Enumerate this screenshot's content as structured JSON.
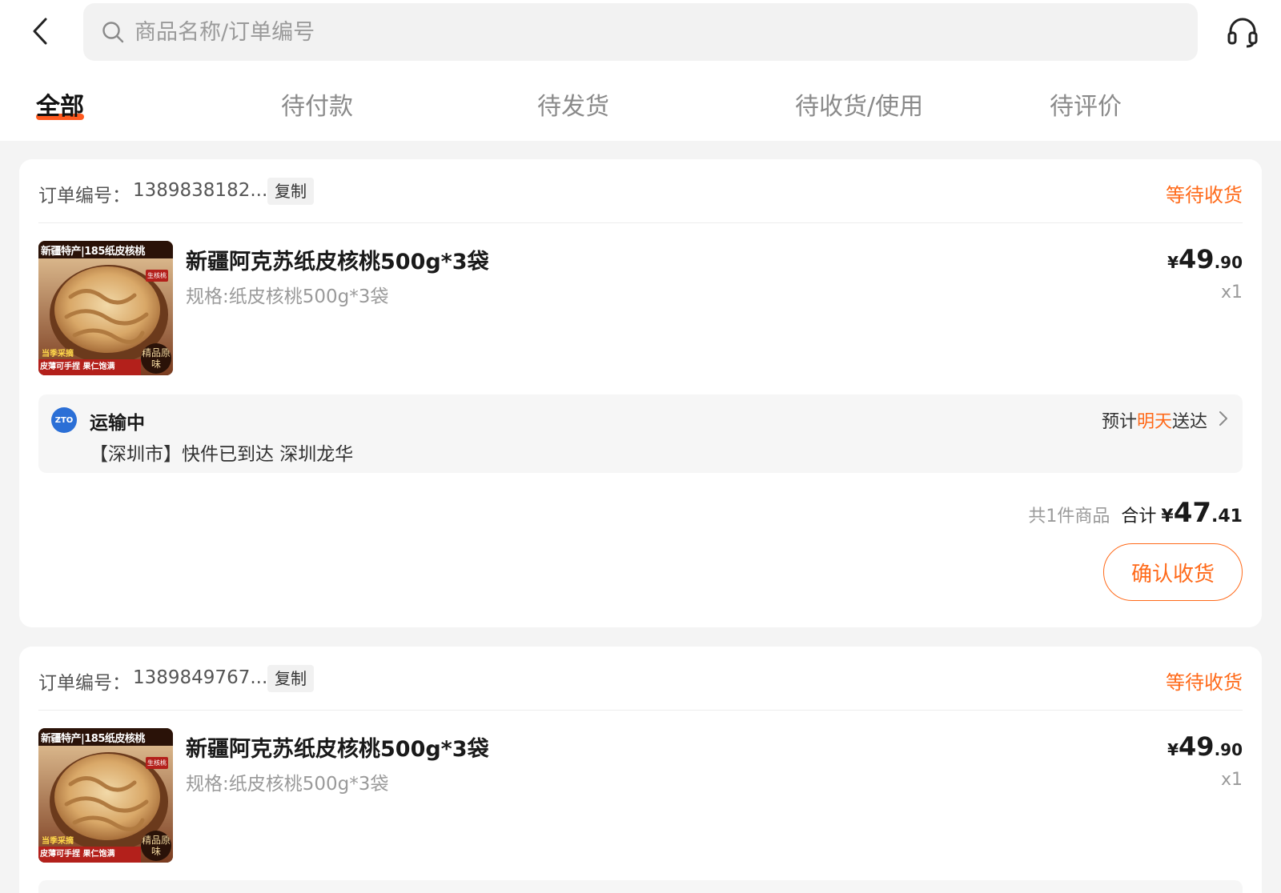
{
  "search": {
    "placeholder": "商品名称/订单编号"
  },
  "tabs": [
    {
      "label": "全部"
    },
    {
      "label": "待付款"
    },
    {
      "label": "待发货"
    },
    {
      "label": "待收货/使用"
    },
    {
      "label": "待评价"
    }
  ],
  "colors": {
    "accent": "#ff6a1a",
    "tab_underline": "#ff5a1f",
    "carrier_blue": "#2b6fd6"
  },
  "icons": {
    "back": "chevron-left-icon",
    "search": "search-icon",
    "service": "headset-icon",
    "eta": "chevron-right-icon"
  },
  "orders": [
    {
      "label": "订单编号：",
      "order_no": "1389838182...",
      "copy": "复制",
      "status": "等待收货",
      "product": {
        "title": "新疆阿克苏纸皮核桃500g*3袋",
        "spec": "规格:纸皮核桃500g*3袋",
        "price_cur": "¥",
        "price_int": "49",
        "price_dec": ".90",
        "qty": "x1",
        "thumb": {
          "banner": "新疆特产|185纸皮核桃",
          "badge": "生核桃",
          "tag_top": "当季采摘",
          "tag_bottom": "皮薄可手捏  果仁饱满",
          "corner": "精品原味"
        }
      },
      "logistics": {
        "carrier_logo": "ZTO",
        "status": "运输中",
        "detail": "【深圳市】快件已到达 深圳龙华",
        "eta_prefix": "预计",
        "eta_highlight": "明天",
        "eta_suffix": "送达"
      },
      "summary": {
        "count": "共1件商品",
        "total_label": "合计",
        "cur": "¥",
        "int": "47",
        "dec": ".41"
      },
      "action": "确认收货"
    },
    {
      "label": "订单编号：",
      "order_no": "1389849767...",
      "copy": "复制",
      "status": "等待收货",
      "product": {
        "title": "新疆阿克苏纸皮核桃500g*3袋",
        "spec": "规格:纸皮核桃500g*3袋",
        "price_cur": "¥",
        "price_int": "49",
        "price_dec": ".90",
        "qty": "x1",
        "thumb": {
          "banner": "新疆特产|185纸皮核桃",
          "badge": "生核桃",
          "tag_top": "当季采摘",
          "tag_bottom": "皮薄可手捏  果仁饱满",
          "corner": "精品原味"
        }
      }
    }
  ]
}
